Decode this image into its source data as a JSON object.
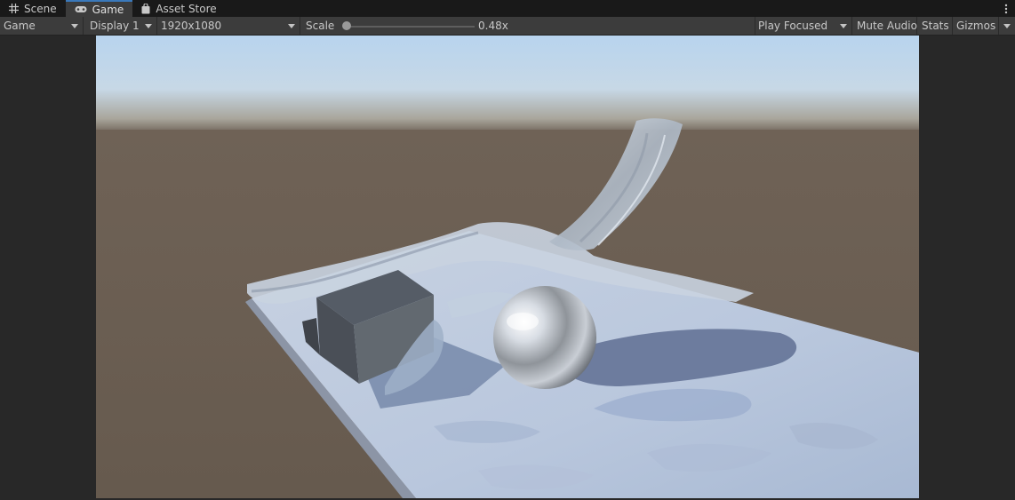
{
  "tabs": [
    {
      "label": "Scene",
      "icon": "grid-icon",
      "active": false
    },
    {
      "label": "Game",
      "icon": "gamepad-icon",
      "active": true
    },
    {
      "label": "Asset Store",
      "icon": "shopping-bag-icon",
      "active": false
    }
  ],
  "toolbar": {
    "view_mode": "Game",
    "display": "Display 1",
    "resolution": "1920x1080",
    "scale_label": "Scale",
    "scale_value": "0.48x",
    "play_mode": "Play Focused",
    "mute_audio": "Mute Audio",
    "stats": "Stats",
    "gizmos": "Gizmos"
  },
  "colors": {
    "accent": "#3a79bb",
    "panel": "#3c3c3c",
    "background": "#282828",
    "sky": "#b9d3ea",
    "ground": "#6b5d50",
    "water": "#b6c6dd"
  }
}
